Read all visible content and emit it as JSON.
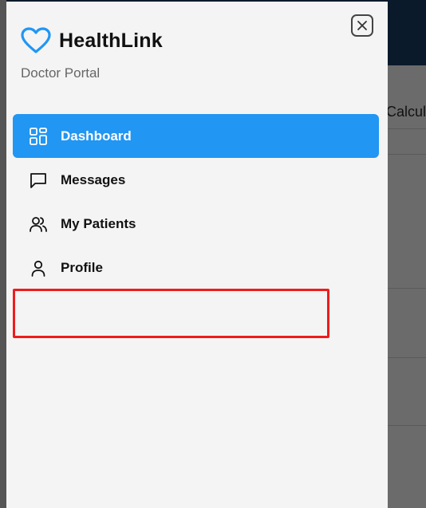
{
  "background": {
    "partial_label": "Calcula"
  },
  "drawer": {
    "brand": {
      "title": "HealthLink",
      "subtitle": "Doctor Portal",
      "logo_icon": "heart-icon",
      "accent_color": "#2196f3"
    },
    "close_icon": "close-icon",
    "nav": [
      {
        "label": "Dashboard",
        "icon": "dashboard-grid-icon",
        "active": true
      },
      {
        "label": "Messages",
        "icon": "message-icon",
        "active": false
      },
      {
        "label": "My Patients",
        "icon": "users-icon",
        "active": false
      },
      {
        "label": "Profile",
        "icon": "user-icon",
        "active": false
      }
    ],
    "highlight_color": "#ee1c1c"
  }
}
